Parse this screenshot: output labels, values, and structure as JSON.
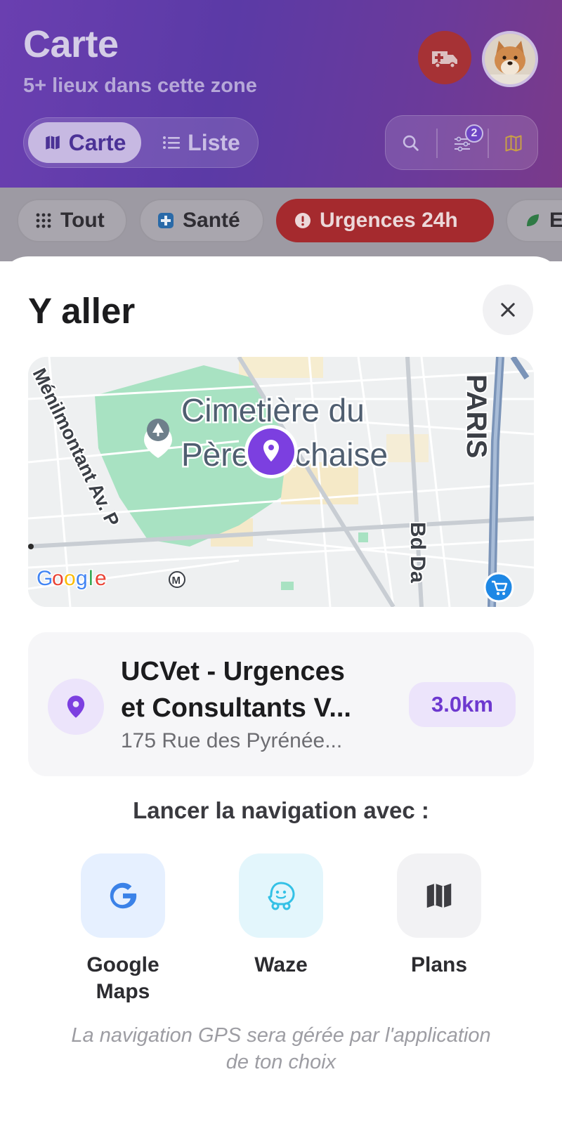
{
  "header": {
    "title": "Carte",
    "subtitle": "5+ lieux dans cette zone",
    "view_toggle": {
      "map_label": "Carte",
      "list_label": "Liste",
      "selected": "Carte"
    },
    "filter_count": "2"
  },
  "categories": [
    {
      "label": "Tout",
      "icon": "grid-icon"
    },
    {
      "label": "Santé",
      "icon": "medical-cross-icon"
    },
    {
      "label": "Urgences 24h",
      "icon": "alert-icon",
      "active": true
    },
    {
      "label": "E",
      "icon": "leaf-icon"
    }
  ],
  "sheet": {
    "title": "Y aller",
    "map": {
      "place_label_line1": "Cimetière du",
      "place_label_line2": "Père Lachaise",
      "street_menilmontant": "Ménilmontant Av. P",
      "street_bd": "Bd Da",
      "city_label": "PARIS",
      "google_letters": [
        "G",
        "o",
        "o",
        "g",
        "l",
        "e"
      ],
      "metro_symbol": "M"
    },
    "place": {
      "name_line1": "UCVet - Urgences",
      "name_line2": "et Consultants V...",
      "address": "175 Rue des Pyrénée...",
      "distance": "3.0km"
    },
    "nav_heading": "Lancer la navigation avec :",
    "apps": [
      {
        "label_line1": "Google",
        "label_line2": "Maps",
        "icon": "google-g-icon",
        "bg": "#e6f0ff"
      },
      {
        "label_line1": "Waze",
        "label_line2": "",
        "icon": "waze-icon",
        "bg": "#e3f6fc"
      },
      {
        "label_line1": "Plans",
        "label_line2": "",
        "icon": "map-folded-icon",
        "bg": "#f2f2f4"
      }
    ],
    "footnote_line1": "La navigation GPS sera gérée par l'application",
    "footnote_line2": "de ton choix"
  },
  "colors": {
    "accent_purple": "#6d38cf",
    "emergency_red": "#a52a2e",
    "header_gradient_start": "#6a3fb0",
    "header_gradient_end": "#7a3a8a",
    "park_green": "#a8e2c2"
  }
}
